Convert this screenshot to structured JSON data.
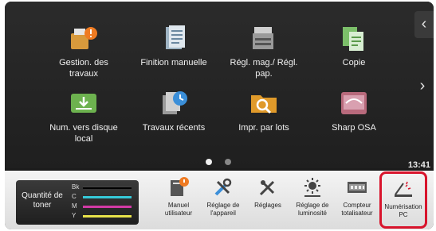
{
  "tiles": [
    {
      "label": "Gestion. des travaux",
      "icon": "job-status-icon"
    },
    {
      "label": "Finition manuelle",
      "icon": "finishing-icon"
    },
    {
      "label": "Régl. mag./ Régl. pap.",
      "icon": "tray-settings-icon"
    },
    {
      "label": "Copie",
      "icon": "copy-icon"
    },
    {
      "label": "Num. vers disque local",
      "icon": "scan-to-local-drive-icon"
    },
    {
      "label": "Travaux récents",
      "icon": "recent-jobs-icon"
    },
    {
      "label": "Impr. par lots",
      "icon": "batch-print-icon"
    },
    {
      "label": "Sharp OSA",
      "icon": "sharp-osa-icon"
    }
  ],
  "pagination": {
    "current": 1,
    "total": 2
  },
  "clock": "13:41",
  "toner": {
    "label": "Quantité de toner",
    "channels": [
      {
        "name": "Bk",
        "color": "#000000",
        "level": 0.95
      },
      {
        "name": "C",
        "color": "#36c9d9",
        "level": 0.95
      },
      {
        "name": "M",
        "color": "#d23aa6",
        "level": 0.95
      },
      {
        "name": "Y",
        "color": "#e8e24a",
        "level": 0.95
      }
    ]
  },
  "dock": [
    {
      "label": "Manuel utilisateur",
      "icon": "user-manual-icon"
    },
    {
      "label": "Réglage de l'appareil",
      "icon": "device-settings-icon"
    },
    {
      "label": "Réglages",
      "icon": "settings-icon"
    },
    {
      "label": "Réglage de luminosité",
      "icon": "brightness-icon"
    },
    {
      "label": "Compteur totalisateur",
      "icon": "counter-icon"
    },
    {
      "label": "Numérisation PC",
      "icon": "pc-scan-icon",
      "selected": true
    }
  ],
  "colors": {
    "highlight": "#d8142c"
  }
}
